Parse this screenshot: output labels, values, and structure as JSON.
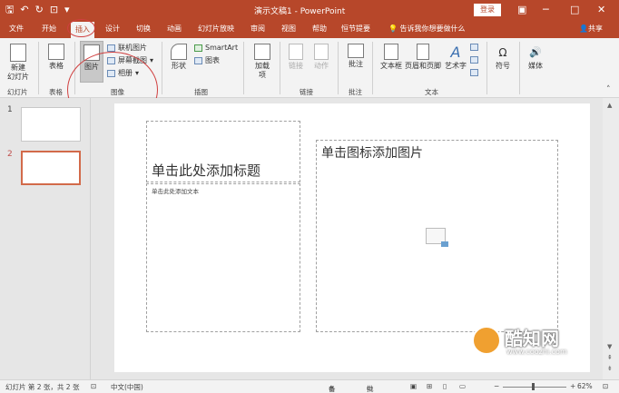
{
  "titlebar": {
    "qat_save": "🖫",
    "qat_undo": "↶",
    "qat_redo": "↻",
    "qat_start": "⊡",
    "qat_more": "▾",
    "title": "演示文稿1 - PowerPoint",
    "login": "登录",
    "restore": "▣",
    "minimize": "─",
    "maximize": "□",
    "close": "✕"
  },
  "tabs": [
    "文件",
    "开始",
    "插入",
    "设计",
    "切换",
    "动画",
    "幻灯片放映",
    "审阅",
    "视图",
    "帮助",
    "恒节提要"
  ],
  "tellme": "告诉我你想要做什么",
  "share": "共享",
  "ribbon": {
    "new_slide": "新建\n幻灯片",
    "table": "表格",
    "picture": "图片",
    "online_pic": "联机图片",
    "screenshot": "屏幕截图",
    "album": "相册",
    "shapes": "形状",
    "smartart": "SmartArt",
    "chart": "图表",
    "addins": "加载\n项",
    "link": "链接",
    "action": "动作",
    "comment": "批注",
    "textbox": "文本框",
    "header_footer": "页眉和页脚",
    "wordart": "艺术字",
    "symbol": "符号",
    "media": "媒体",
    "groups": {
      "slides": "幻灯片",
      "table": "表格",
      "images": "图像",
      "illustrations": "插图",
      "links": "链接",
      "comments": "批注",
      "text": "文本"
    },
    "tooltip": "图片"
  },
  "thumbs": [
    {
      "num": "1"
    },
    {
      "num": "2"
    }
  ],
  "slide": {
    "title_ph": "单击此处添加标题",
    "body_ph": "单击此处添加文本",
    "pic_ph": "单击图标添加图片"
  },
  "status": {
    "slide_info": "幻灯片 第 2 张，共 2 张",
    "lang": "中文(中国)",
    "notes": "备注",
    "comments": "批注",
    "zoom": "62%"
  },
  "watermark": {
    "name": "酷知网",
    "url": "www.coozhi.com"
  },
  "colors": {
    "accent": "#b7472a",
    "selected_thumb": "#d26a4a"
  }
}
